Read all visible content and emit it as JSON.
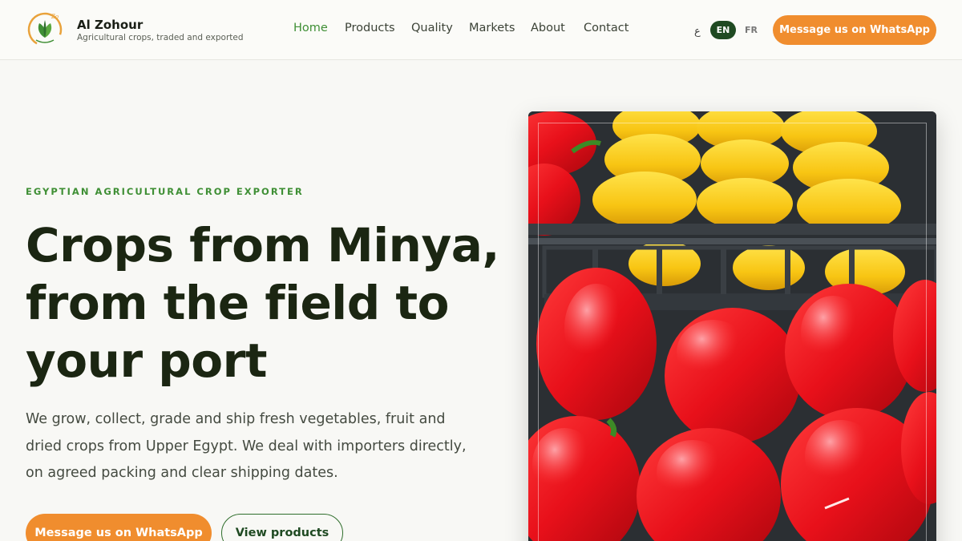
{
  "brand": {
    "name": "Al Zohour",
    "tagline": "Agricultural crops, traded and exported",
    "logo_icon": "leaf-logo-icon"
  },
  "nav": {
    "items": [
      {
        "label": "Home",
        "active": true
      },
      {
        "label": "Products",
        "active": false
      },
      {
        "label": "Quality",
        "active": false
      },
      {
        "label": "Markets",
        "active": false
      },
      {
        "label": "About",
        "active": false
      },
      {
        "label": "Contact",
        "active": false
      }
    ]
  },
  "languages": {
    "ar": "ع",
    "en": "EN",
    "fr": "FR",
    "selected": "EN"
  },
  "header_cta": "Message us on WhatsApp",
  "hero": {
    "eyebrow": "EGYPTIAN AGRICULTURAL CROP EXPORTER",
    "title_lines": [
      "Crops from Minya,",
      "from the field to",
      "your port"
    ],
    "description": "We grow, collect, grade and ship fresh vegetables, fruit and dried crops from Upper Egypt. We deal with importers directly, on agreed packing and clear shipping dates.",
    "primary_button": "Message us on WhatsApp",
    "secondary_button": "View products",
    "image": "bell-peppers-crate-photo"
  },
  "colors": {
    "accent_green": "#3f8f35",
    "dark_green": "#1f4a22",
    "orange": "#f08d2e",
    "title": "#1b2612"
  }
}
